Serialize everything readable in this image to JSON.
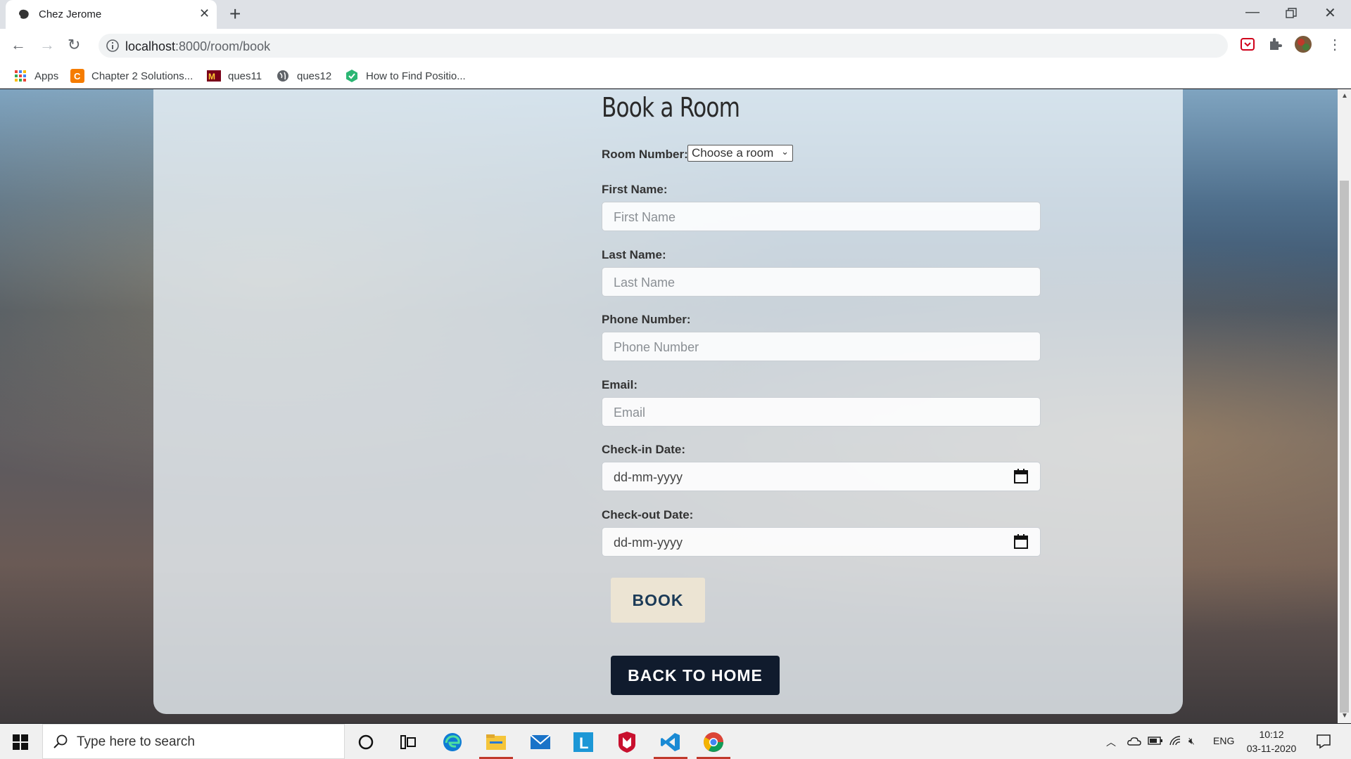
{
  "browser": {
    "tab_title": "Chez Jerome",
    "tab_close": "✕",
    "new_tab": "+",
    "url_host": "localhost",
    "url_path": ":8000/room/book",
    "window_controls": [
      "minimize",
      "restore",
      "close"
    ]
  },
  "bookmarks": [
    {
      "label": "Apps",
      "icon": "apps-grid-icon"
    },
    {
      "label": "Chapter 2 Solutions...",
      "icon": "chegg-icon"
    },
    {
      "label": "ques11",
      "icon": "minnesota-icon"
    },
    {
      "label": "ques12",
      "icon": "globe-icon"
    },
    {
      "label": "How to Find Positio...",
      "icon": "hexagon-icon"
    }
  ],
  "form": {
    "heading": "Book a Room",
    "room_label": "Room Number:",
    "room_select": "Choose a room",
    "first_name_label": "First Name:",
    "first_name_placeholder": "First Name",
    "last_name_label": "Last Name:",
    "last_name_placeholder": "Last Name",
    "phone_label": "Phone Number:",
    "phone_placeholder": "Phone Number",
    "email_label": "Email:",
    "email_placeholder": "Email",
    "checkin_label": "Check-in Date:",
    "checkin_placeholder": "dd-mm-yyyy",
    "checkout_label": "Check-out Date:",
    "checkout_placeholder": "dd-mm-yyyy",
    "book_button": "BOOK",
    "home_button": "BACK TO HOME"
  },
  "taskbar": {
    "search_placeholder": "Type here to search",
    "apps": [
      "cortana-icon",
      "task-view-icon",
      "edge-icon",
      "file-explorer-icon",
      "mail-icon",
      "l-app-icon",
      "mcafee-icon",
      "vscode-icon",
      "chrome-icon"
    ],
    "language": "ENG",
    "time": "10:12",
    "date": "03-11-2020"
  },
  "colors": {
    "book_button_bg": "#ece4d3",
    "home_button_bg": "#101b2d",
    "panel_bg": "rgba(235,242,247,0.80)"
  }
}
